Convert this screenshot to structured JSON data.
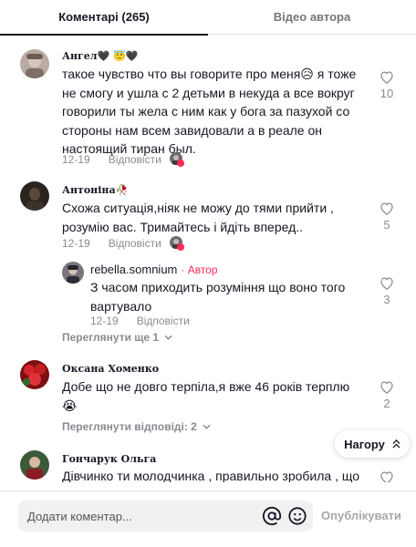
{
  "tabs": [
    {
      "label": "Коментарі (265)",
      "active": true
    },
    {
      "label": "Відео автора",
      "active": false
    }
  ],
  "comments": [
    {
      "username": "Ангел🖤 😇🖤",
      "text": "такое чувство что вы говорите про меня😥 я тоже не смогу и ушла с 2 детьми в некуда а все вокруг говорили ты желa с ним как у бога за пазухой со стороны нам всем завидовали а в реале он настоящий тиран был.",
      "date": "12-19",
      "reply_label": "Відповісти",
      "likes": "10"
    },
    {
      "username": "Антоніна🥀",
      "text": "Схожа ситуація,ніяк не можу до тями прийти , розумію вас. Тримайтесь і йдіть вперед..",
      "date": "12-19",
      "reply_label": "Відповісти",
      "likes": "5",
      "reply": {
        "username": "rebella.somnium",
        "author_badge": "· Автор",
        "text": "З часом приходить розуміння що воно того вартувало",
        "date": "12-19",
        "reply_label": "Відповісти",
        "likes": "3"
      },
      "more_label": "Переглянути ще 1"
    },
    {
      "username": "Оксана Хоменко",
      "text": "Добе що не довго терпіла,я вже 46 років терплю😭",
      "date": "",
      "likes": "2",
      "more_label": "Переглянути відповіді: 2"
    },
    {
      "username": "Гончарук Ольга",
      "text": "Дівчинко ти молодчинка , правильно зробила , що"
    }
  ],
  "float_button": {
    "label": "Нагору"
  },
  "footer": {
    "placeholder": "Додати коментар...",
    "publish_label": "Опублікувати"
  },
  "colors": {
    "accent": "#fe2c55",
    "muted_text": "#8a8b91",
    "primary_text": "#161823",
    "input_bg": "#f1f1f2"
  },
  "icons": [
    "heart-icon",
    "at-icon",
    "emoji-icon",
    "chevron-down-icon",
    "chevron-up-icon"
  ]
}
